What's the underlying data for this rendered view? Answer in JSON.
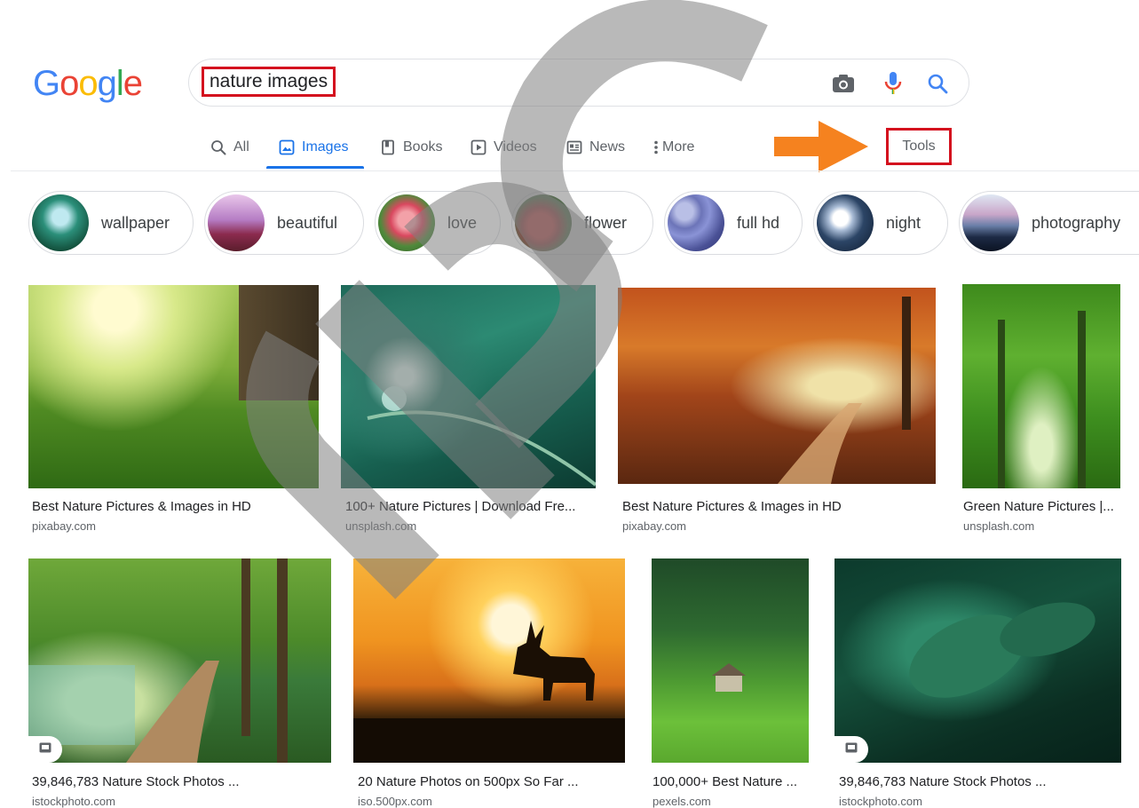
{
  "header": {
    "logo_letters": [
      {
        "ch": "G",
        "color": "#4285f4"
      },
      {
        "ch": "o",
        "color": "#ea4335"
      },
      {
        "ch": "o",
        "color": "#fbbc05"
      },
      {
        "ch": "g",
        "color": "#4285f4"
      },
      {
        "ch": "l",
        "color": "#34a853"
      },
      {
        "ch": "e",
        "color": "#ea4335"
      }
    ],
    "search_value": "nature images",
    "icons": [
      "camera-icon",
      "microphone-icon",
      "search-icon"
    ]
  },
  "tabs": [
    {
      "label": "All",
      "icon": "search-icon",
      "active": false
    },
    {
      "label": "Images",
      "icon": "image-icon",
      "active": true
    },
    {
      "label": "Books",
      "icon": "book-icon",
      "active": false
    },
    {
      "label": "Videos",
      "icon": "play-icon",
      "active": false
    },
    {
      "label": "News",
      "icon": "news-icon",
      "active": false
    },
    {
      "label": "More",
      "icon": "more-vert-icon",
      "active": false
    }
  ],
  "tools_label": "Tools",
  "chips": [
    {
      "label": "wallpaper"
    },
    {
      "label": "beautiful"
    },
    {
      "label": "love"
    },
    {
      "label": "flower"
    },
    {
      "label": "full hd"
    },
    {
      "label": "night"
    },
    {
      "label": "photography"
    }
  ],
  "results": [
    {
      "title": "Best Nature Pictures & Images in HD",
      "source": "pixabay.com"
    },
    {
      "title": "100+ Nature Pictures | Download Fre...",
      "source": "unsplash.com"
    },
    {
      "title": "Best Nature Pictures & Images in HD",
      "source": "pixabay.com"
    },
    {
      "title": "Green Nature Pictures |...",
      "source": "unsplash.com"
    },
    {
      "title": "39,846,783 Nature Stock Photos ...",
      "source": "istockphoto.com",
      "badge": true
    },
    {
      "title": "20 Nature Photos on 500px So Far ...",
      "source": "iso.500px.com"
    },
    {
      "title": "100,000+ Best Nature ...",
      "source": "pexels.com"
    },
    {
      "title": "39,846,783 Nature Stock Photos ...",
      "source": "istockphoto.com",
      "badge": true
    }
  ],
  "colors": {
    "accent": "#1a73e8",
    "highlight_box": "#d4101e",
    "arrow": "#f5821f"
  }
}
